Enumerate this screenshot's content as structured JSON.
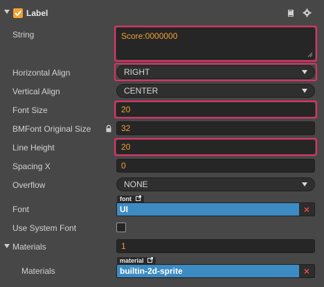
{
  "header": {
    "title": "Label",
    "enabled": true,
    "icons": [
      "book-icon",
      "gear-icon"
    ]
  },
  "properties": {
    "string": {
      "label": "String",
      "value": "Score:0000000"
    },
    "horizontal_align": {
      "label": "Horizontal Align",
      "value": "RIGHT"
    },
    "vertical_align": {
      "label": "Vertical Align",
      "value": "CENTER"
    },
    "font_size": {
      "label": "Font Size",
      "value": "20"
    },
    "bmfont_original_size": {
      "label": "BMFont Original Size",
      "value": "32"
    },
    "line_height": {
      "label": "Line Height",
      "value": "20"
    },
    "spacing_x": {
      "label": "Spacing X",
      "value": "0"
    },
    "overflow": {
      "label": "Overflow",
      "value": "NONE"
    },
    "font": {
      "label": "Font",
      "tag": "font",
      "value": "UI"
    },
    "use_system_font": {
      "label": "Use System Font",
      "checked": false
    },
    "materials_count": {
      "label": "Materials",
      "value": "1"
    },
    "materials_item": {
      "label": "Materials",
      "tag": "material",
      "value": "builtin-2d-sprite"
    }
  },
  "colors": {
    "accent": "#f0a235",
    "highlight": "#e32f64",
    "asset": "#3d8bc3",
    "background": "#474747"
  }
}
